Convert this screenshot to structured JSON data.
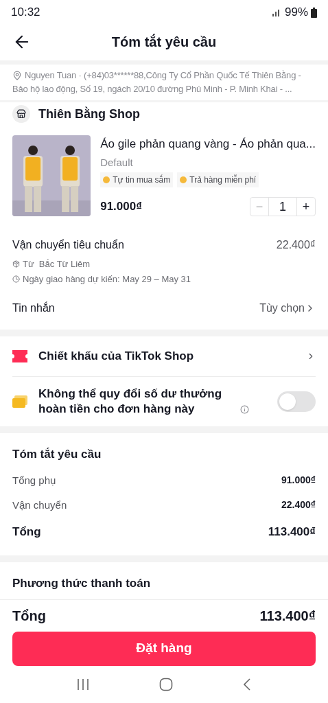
{
  "status_bar": {
    "time": "10:32",
    "battery": "99%"
  },
  "header": {
    "title": "Tóm tắt yêu cầu"
  },
  "address": {
    "text": "Nguyen Tuan · (+84)03******88,Công Ty Cổ Phần Quốc Tế Thiên Bằng - Bảo hộ lao động, Số 19, ngách 20/10 đường Phú Minh - P. Minh Khai - ..."
  },
  "shop": {
    "name": "Thiên Bằng Shop"
  },
  "product": {
    "kind": "picture",
    "title": "Áo gile phản quang vàng - Áo phản qua...",
    "variant": "Default",
    "badges": [
      "Tự tin mua sắm",
      "Trả hàng miễn phí"
    ],
    "price": "91.000₫",
    "quantity": "1",
    "minus": "−",
    "plus": "+"
  },
  "shipping": {
    "method": "Vận chuyển tiêu chuẩn",
    "fee": "22.400₫",
    "origin": "Từ  Bắc Từ Liêm",
    "eta": "Ngày giao hàng dự kiến: May 29 – May 31"
  },
  "message": {
    "label": "Tin nhắn",
    "value": "Tùy chọn"
  },
  "discount": {
    "label": "Chiết khấu của TikTok Shop"
  },
  "cashback": {
    "label": "Không thể quy đổi số dư thưởng hoàn tiền cho đơn hàng này",
    "on": false
  },
  "summary": {
    "title": "Tóm tắt yêu cầu",
    "rows": [
      {
        "label": "Tổng phụ",
        "value": "91.000₫",
        "bold": false
      },
      {
        "label": "Vận chuyển",
        "value": "22.400₫",
        "bold": false
      },
      {
        "label": "Tổng",
        "value": "113.400₫",
        "bold": true
      }
    ]
  },
  "payment": {
    "title": "Phương thức thanh toán"
  },
  "footer": {
    "total_label": "Tổng",
    "total_value": "113.400₫",
    "button": "Đặt hàng"
  }
}
